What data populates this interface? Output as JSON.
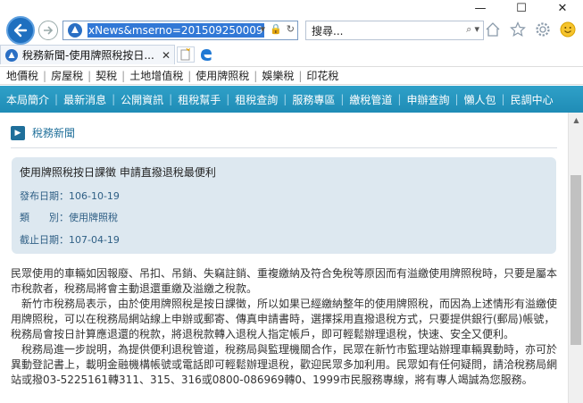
{
  "window": {
    "minimize": "—",
    "maximize": "☐",
    "close": "✕"
  },
  "address": {
    "url": "xNews&mserno=201509250009",
    "search_placeholder": "搜尋..."
  },
  "tab": {
    "title": "稅務新聞-使用牌照稅按日..."
  },
  "tax_menu": [
    "地價稅",
    "房屋稅",
    "契稅",
    "土地增值稅",
    "使用牌照稅",
    "娛樂稅",
    "印花稅"
  ],
  "nav_menu": [
    "本局簡介",
    "最新消息",
    "公開資訊",
    "租稅幫手",
    "租稅查詢",
    "服務專區",
    "繳稅管道",
    "申辦查詢",
    "懶人包",
    "民調中心"
  ],
  "section": {
    "title": "稅務新聞"
  },
  "info": {
    "headline": "使用牌照稅按日課徵 申請直撥退稅最便利",
    "publish_label": "發布日期：",
    "publish_date": "106-10-19",
    "category_label": "類　　別：",
    "category": "使用牌照稅",
    "expiry_label": "截止日期：",
    "expiry_date": "107-04-19"
  },
  "article": {
    "p1": "民眾使用的車輛如因報廢、吊扣、吊銷、失竊註銷、重複繳納及符合免稅等原因而有溢繳使用牌照稅時，只要是屬本市稅款者，稅務局將會主動退還重繳及溢繳之稅款。",
    "p2": "　新竹市稅務局表示，由於使用牌照稅是按日課徵，所以如果已經繳納整年的使用牌照稅，而因為上述情形有溢繳使用牌照稅，可以在稅務局網站線上申辦或郵寄、傳真申請書時，選擇採用直撥退稅方式，只要提供銀行(郵局)帳號，稅務局會按日計算應退還的稅款，將退稅款轉入退稅人指定帳戶，即可輕鬆辦理退稅，快速、安全又便利。",
    "p3": "　稅務局進一步說明，為提供便利退稅管道，稅務局與監理機關合作，民眾在新竹市監理站辦理車輛異動時，亦可於異動登記書上，載明金融機構帳號或電話即可輕鬆辦理退稅，歡迎民眾多加利用。民眾如有任何疑問，請洽稅務局網站或撥03-5225161轉311、315、316或0800-086969轉0、1999市民服務專線，將有專人竭誠為您服務。"
  },
  "colors": {
    "nav_bar": "#1f8cb6",
    "info_box": "#dde8f0",
    "section_accent": "#1f6f9a",
    "url_highlight": "#3178d6"
  }
}
